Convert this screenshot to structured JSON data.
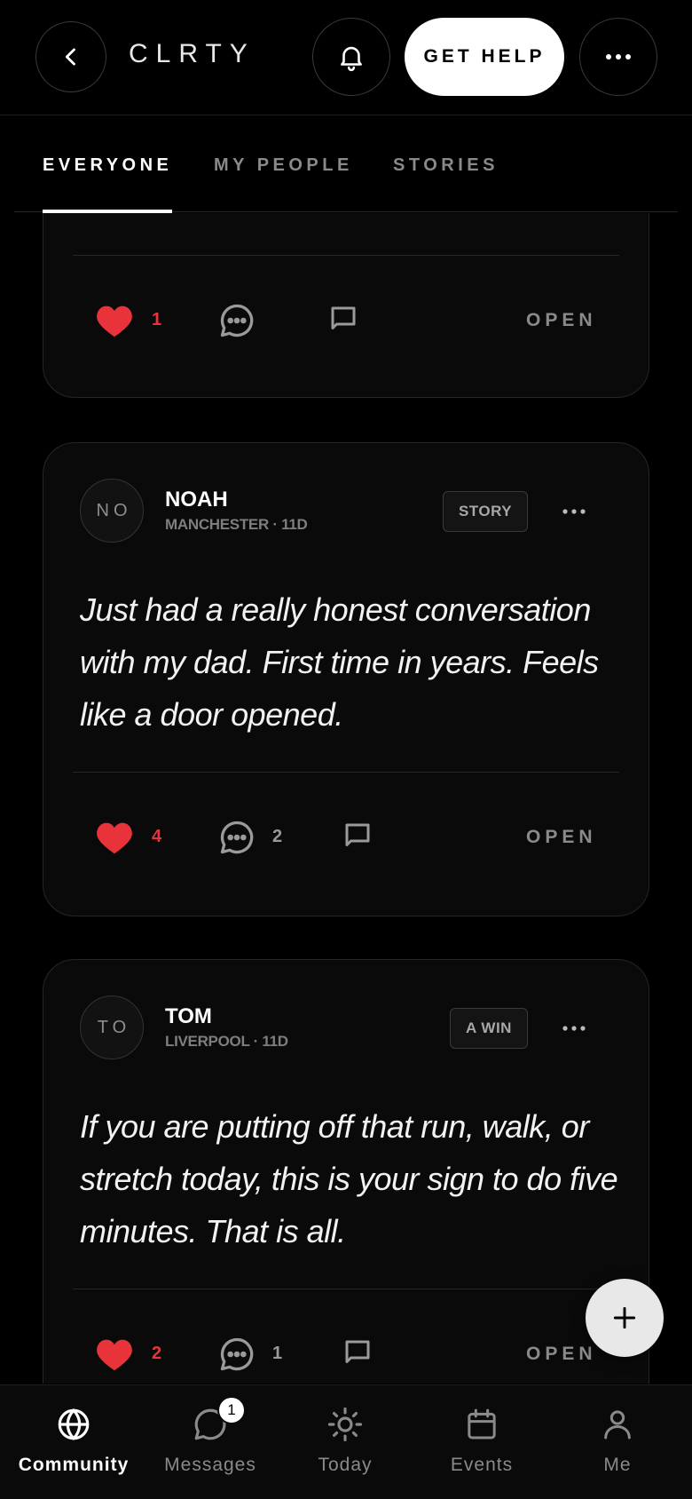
{
  "header": {
    "brand": "CLRTY",
    "help_label": "GET HELP",
    "icons": [
      "chevron-left-icon",
      "bell-icon",
      "more-horizontal-icon"
    ]
  },
  "tabs": [
    {
      "label": "EVERYONE",
      "active": true
    },
    {
      "label": "MY PEOPLE",
      "active": false
    },
    {
      "label": "STORIES",
      "active": false
    }
  ],
  "colors": {
    "background": "#000000",
    "card": "#0a0a0a",
    "like_red": "#e8333a",
    "muted": "#8a8a8a"
  },
  "posts": [
    {
      "author": "",
      "meta": "",
      "tag": "",
      "body": "",
      "likes": "1",
      "comments": "",
      "open_label": "OPEN"
    },
    {
      "initials": "NO",
      "author": "NOAH",
      "meta": "MANCHESTER · 11D",
      "tag": "STORY",
      "body": "Just had a really honest conversation with my dad. First time in years. Feels like a door opened.",
      "likes": "4",
      "comments": "2",
      "open_label": "OPEN"
    },
    {
      "initials": "TO",
      "author": "TOM",
      "meta": "LIVERPOOL · 11D",
      "tag": "A WIN",
      "body": "If you are putting off that run, walk, or stretch today, this is your sign to do five minutes. That is all.",
      "likes": "2",
      "comments": "1",
      "open_label": "OPEN"
    }
  ],
  "fab": {
    "icon": "plus-icon"
  },
  "bottom_nav": [
    {
      "label": "Community",
      "icon": "globe-icon",
      "active": true
    },
    {
      "label": "Messages",
      "icon": "chat-bubble-icon",
      "badge": "1"
    },
    {
      "label": "Today",
      "icon": "sun-icon"
    },
    {
      "label": "Events",
      "icon": "calendar-icon"
    },
    {
      "label": "Me",
      "icon": "person-icon"
    }
  ]
}
